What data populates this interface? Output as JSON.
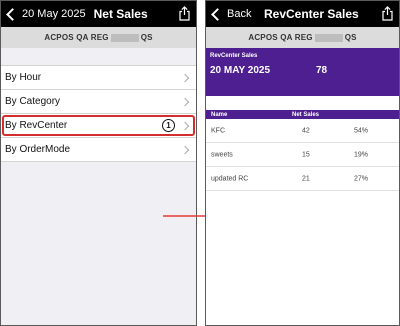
{
  "left": {
    "date": "20 May 2025",
    "title": "Net Sales",
    "subhead_prefix": "ACPOS QA REG",
    "subhead_suffix": "QS",
    "menu": [
      {
        "label": "By Hour"
      },
      {
        "label": "By Category"
      },
      {
        "label": "By RevCenter",
        "step": "1"
      },
      {
        "label": "By OrderMode"
      }
    ]
  },
  "right": {
    "back_label": "Back",
    "title": "RevCenter Sales",
    "subhead_prefix": "ACPOS QA REG",
    "subhead_suffix": "QS",
    "banner": {
      "title": "RevCenter Sales",
      "date": "20 MAY 2025",
      "total": "78"
    },
    "columns": {
      "name": "Name",
      "net_sales": "Net Sales",
      "pct": ""
    },
    "rows": [
      {
        "name": "KFC",
        "net_sales": "42",
        "pct": "54%"
      },
      {
        "name": "sweets",
        "net_sales": "15",
        "pct": "19%"
      },
      {
        "name": "updated RC",
        "net_sales": "21",
        "pct": "27%"
      }
    ]
  },
  "colors": {
    "navbar": "#000000",
    "accent_purple": "#4d1f91",
    "highlight_red": "#d32f2f",
    "arrow_red": "#e53935"
  }
}
